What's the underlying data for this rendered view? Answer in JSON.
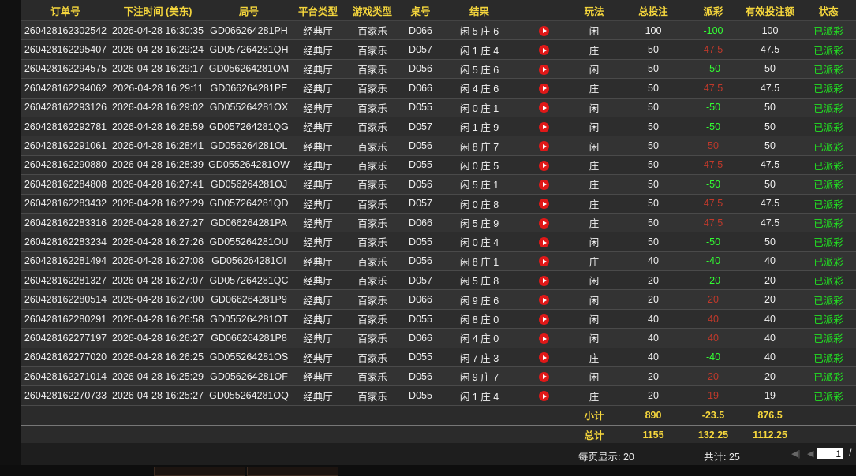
{
  "columns": [
    "订单号",
    "下注时间 (美东)",
    "局号",
    "平台类型",
    "游戏类型",
    "桌号",
    "结果",
    "",
    "玩法",
    "总投注",
    "派彩",
    "有效投注额",
    "状态"
  ],
  "rows": [
    {
      "order": "260428162302542",
      "time": "2026-04-28 16:30:35",
      "round": "GD066264281PH",
      "platform": "经典厅",
      "game": "百家乐",
      "table": "D066",
      "result": "闲 5 庄 6",
      "play": "闲",
      "bet": "100",
      "payout": "-100",
      "payout_type": "win",
      "valid": "100",
      "status": "已派彩"
    },
    {
      "order": "260428162295407",
      "time": "2026-04-28 16:29:24",
      "round": "GD057264281QH",
      "platform": "经典厅",
      "game": "百家乐",
      "table": "D057",
      "result": "闲 1 庄 4",
      "play": "庄",
      "bet": "50",
      "payout": "47.5",
      "payout_type": "lose",
      "valid": "47.5",
      "status": "已派彩"
    },
    {
      "order": "260428162294575",
      "time": "2026-04-28 16:29:17",
      "round": "GD056264281OM",
      "platform": "经典厅",
      "game": "百家乐",
      "table": "D056",
      "result": "闲 5 庄 6",
      "play": "闲",
      "bet": "50",
      "payout": "-50",
      "payout_type": "win",
      "valid": "50",
      "status": "已派彩"
    },
    {
      "order": "260428162294062",
      "time": "2026-04-28 16:29:11",
      "round": "GD066264281PE",
      "platform": "经典厅",
      "game": "百家乐",
      "table": "D066",
      "result": "闲 4 庄 6",
      "play": "庄",
      "bet": "50",
      "payout": "47.5",
      "payout_type": "lose",
      "valid": "47.5",
      "status": "已派彩"
    },
    {
      "order": "260428162293126",
      "time": "2026-04-28 16:29:02",
      "round": "GD055264281OX",
      "platform": "经典厅",
      "game": "百家乐",
      "table": "D055",
      "result": "闲 0 庄 1",
      "play": "闲",
      "bet": "50",
      "payout": "-50",
      "payout_type": "win",
      "valid": "50",
      "status": "已派彩"
    },
    {
      "order": "260428162292781",
      "time": "2026-04-28 16:28:59",
      "round": "GD057264281QG",
      "platform": "经典厅",
      "game": "百家乐",
      "table": "D057",
      "result": "闲 1 庄 9",
      "play": "闲",
      "bet": "50",
      "payout": "-50",
      "payout_type": "win",
      "valid": "50",
      "status": "已派彩"
    },
    {
      "order": "260428162291061",
      "time": "2026-04-28 16:28:41",
      "round": "GD056264281OL",
      "platform": "经典厅",
      "game": "百家乐",
      "table": "D056",
      "result": "闲 8 庄 7",
      "play": "闲",
      "bet": "50",
      "payout": "50",
      "payout_type": "lose",
      "valid": "50",
      "status": "已派彩"
    },
    {
      "order": "260428162290880",
      "time": "2026-04-28 16:28:39",
      "round": "GD055264281OW",
      "platform": "经典厅",
      "game": "百家乐",
      "table": "D055",
      "result": "闲 0 庄 5",
      "play": "庄",
      "bet": "50",
      "payout": "47.5",
      "payout_type": "lose",
      "valid": "47.5",
      "status": "已派彩"
    },
    {
      "order": "260428162284808",
      "time": "2026-04-28 16:27:41",
      "round": "GD056264281OJ",
      "platform": "经典厅",
      "game": "百家乐",
      "table": "D056",
      "result": "闲 5 庄 1",
      "play": "庄",
      "bet": "50",
      "payout": "-50",
      "payout_type": "win",
      "valid": "50",
      "status": "已派彩"
    },
    {
      "order": "260428162283432",
      "time": "2026-04-28 16:27:29",
      "round": "GD057264281QD",
      "platform": "经典厅",
      "game": "百家乐",
      "table": "D057",
      "result": "闲 0 庄 8",
      "play": "庄",
      "bet": "50",
      "payout": "47.5",
      "payout_type": "lose",
      "valid": "47.5",
      "status": "已派彩"
    },
    {
      "order": "260428162283316",
      "time": "2026-04-28 16:27:27",
      "round": "GD066264281PA",
      "platform": "经典厅",
      "game": "百家乐",
      "table": "D066",
      "result": "闲 5 庄 9",
      "play": "庄",
      "bet": "50",
      "payout": "47.5",
      "payout_type": "lose",
      "valid": "47.5",
      "status": "已派彩"
    },
    {
      "order": "260428162283234",
      "time": "2026-04-28 16:27:26",
      "round": "GD055264281OU",
      "platform": "经典厅",
      "game": "百家乐",
      "table": "D055",
      "result": "闲 0 庄 4",
      "play": "闲",
      "bet": "50",
      "payout": "-50",
      "payout_type": "win",
      "valid": "50",
      "status": "已派彩"
    },
    {
      "order": "260428162281494",
      "time": "2026-04-28 16:27:08",
      "round": "GD056264281OI",
      "platform": "经典厅",
      "game": "百家乐",
      "table": "D056",
      "result": "闲 8 庄 1",
      "play": "庄",
      "bet": "40",
      "payout": "-40",
      "payout_type": "win",
      "valid": "40",
      "status": "已派彩"
    },
    {
      "order": "260428162281327",
      "time": "2026-04-28 16:27:07",
      "round": "GD057264281QC",
      "platform": "经典厅",
      "game": "百家乐",
      "table": "D057",
      "result": "闲 5 庄 8",
      "play": "闲",
      "bet": "20",
      "payout": "-20",
      "payout_type": "win",
      "valid": "20",
      "status": "已派彩"
    },
    {
      "order": "260428162280514",
      "time": "2026-04-28 16:27:00",
      "round": "GD066264281P9",
      "platform": "经典厅",
      "game": "百家乐",
      "table": "D066",
      "result": "闲 9 庄 6",
      "play": "闲",
      "bet": "20",
      "payout": "20",
      "payout_type": "lose",
      "valid": "20",
      "status": "已派彩"
    },
    {
      "order": "260428162280291",
      "time": "2026-04-28 16:26:58",
      "round": "GD055264281OT",
      "platform": "经典厅",
      "game": "百家乐",
      "table": "D055",
      "result": "闲 8 庄 0",
      "play": "闲",
      "bet": "40",
      "payout": "40",
      "payout_type": "lose",
      "valid": "40",
      "status": "已派彩"
    },
    {
      "order": "260428162277197",
      "time": "2026-04-28 16:26:27",
      "round": "GD066264281P8",
      "platform": "经典厅",
      "game": "百家乐",
      "table": "D066",
      "result": "闲 4 庄 0",
      "play": "闲",
      "bet": "40",
      "payout": "40",
      "payout_type": "lose",
      "valid": "40",
      "status": "已派彩"
    },
    {
      "order": "260428162277020",
      "time": "2026-04-28 16:26:25",
      "round": "GD055264281OS",
      "platform": "经典厅",
      "game": "百家乐",
      "table": "D055",
      "result": "闲 7 庄 3",
      "play": "庄",
      "bet": "40",
      "payout": "-40",
      "payout_type": "win",
      "valid": "40",
      "status": "已派彩"
    },
    {
      "order": "260428162271014",
      "time": "2026-04-28 16:25:29",
      "round": "GD056264281OF",
      "platform": "经典厅",
      "game": "百家乐",
      "table": "D056",
      "result": "闲 9 庄 7",
      "play": "闲",
      "bet": "20",
      "payout": "20",
      "payout_type": "lose",
      "valid": "20",
      "status": "已派彩"
    },
    {
      "order": "260428162270733",
      "time": "2026-04-28 16:25:27",
      "round": "GD055264281OQ",
      "platform": "经典厅",
      "game": "百家乐",
      "table": "D055",
      "result": "闲 1 庄 4",
      "play": "庄",
      "bet": "20",
      "payout": "19",
      "payout_type": "lose",
      "valid": "19",
      "status": "已派彩"
    }
  ],
  "subtotal": {
    "label": "小计",
    "bet": "890",
    "payout": "-23.5",
    "valid": "876.5"
  },
  "total": {
    "label": "总计",
    "bet": "1155",
    "payout": "132.25",
    "valid": "1112.25"
  },
  "footer": {
    "per_page": "每页显示: 20",
    "total_count": "共计: 25",
    "page": "1",
    "slash": "/"
  },
  "icons": {
    "result_video": "play-icon",
    "first_page": "first-page-icon",
    "prev_page": "prev-page-icon"
  },
  "colors": {
    "header_text": "#f5d63c",
    "win": "#33ff33",
    "lose": "#c0392b",
    "status": "#22e022",
    "video_icon": "#e01818"
  }
}
